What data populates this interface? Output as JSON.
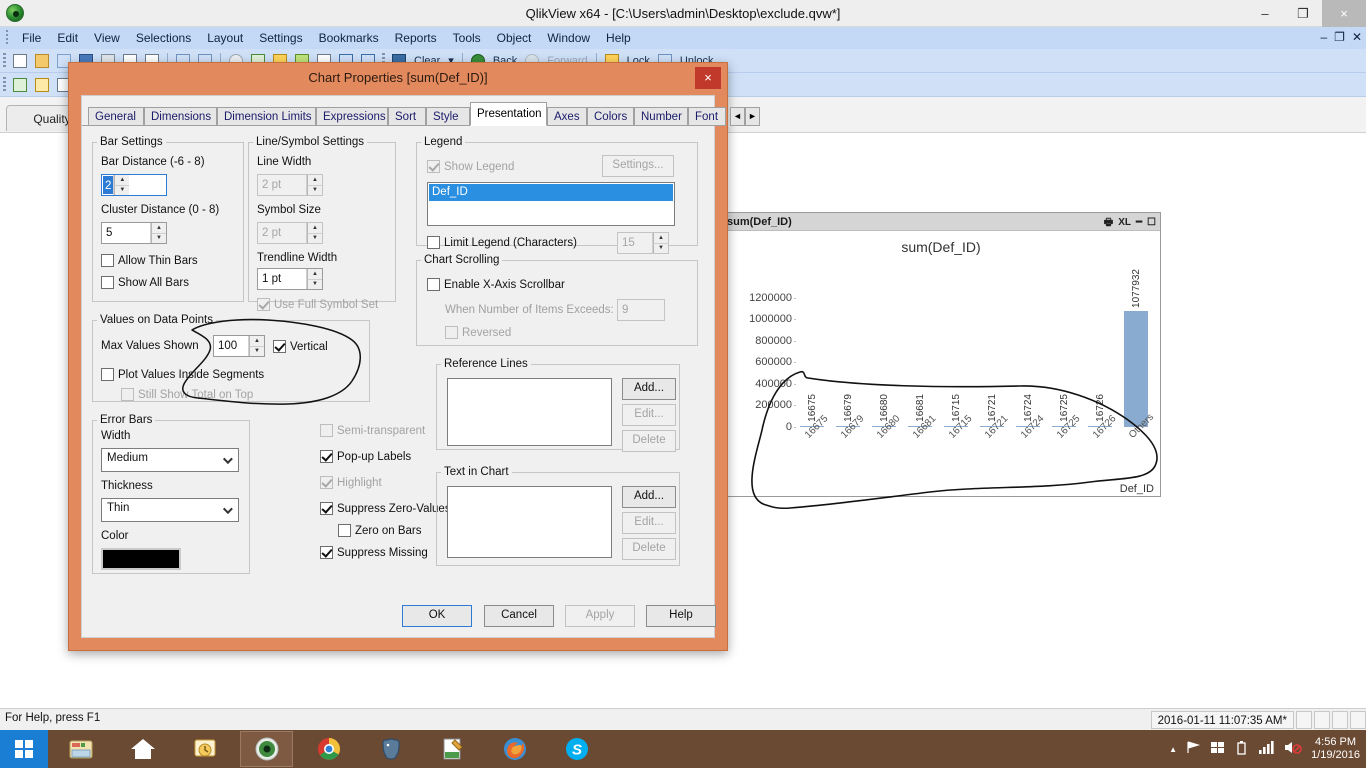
{
  "window": {
    "title": "QlikView x64 - [C:\\Users\\admin\\Desktop\\exclude.qvw*]",
    "app_icon": "qlikview-icon",
    "minimize": "–",
    "maximize": "❐",
    "close": "×",
    "doc_minimize": "–",
    "doc_restore": "❐",
    "doc_close": "✕"
  },
  "menubar": {
    "items": [
      "File",
      "Edit",
      "View",
      "Selections",
      "Layout",
      "Settings",
      "Bookmarks",
      "Reports",
      "Tools",
      "Object",
      "Window",
      "Help"
    ]
  },
  "toolbar": {
    "clear": "Clear",
    "back": "Back",
    "forward": "Forward",
    "lock": "Lock",
    "unlock": "Unlock"
  },
  "document": {
    "sheet_tab": "Quality"
  },
  "chart_object": {
    "caption": "sum(Def_ID)",
    "buttons": [
      "print-icon",
      "XL",
      "minimize-icon",
      "maximize-icon"
    ]
  },
  "chart_data": {
    "type": "bar",
    "title": "sum(Def_ID)",
    "xlabel": "Def_ID",
    "ylabel": "",
    "categories": [
      "16675",
      "16679",
      "16680",
      "16681",
      "16715",
      "16721",
      "16724",
      "16725",
      "16726",
      "Others"
    ],
    "values": [
      16675,
      16679,
      16680,
      16681,
      16715,
      16721,
      16724,
      16725,
      16726,
      1077932
    ],
    "value_labels": [
      "16675",
      "16679",
      "16680",
      "16681",
      "16715",
      "16721",
      "16724",
      "16725",
      "16726",
      "1077932"
    ],
    "ylim": [
      0,
      1300000
    ],
    "yticks": [
      0,
      200000,
      400000,
      600000,
      800000,
      1000000,
      1200000
    ],
    "ytick_labels": [
      "0",
      "200000",
      "400000",
      "600000",
      "800000",
      "1000000",
      "1200000"
    ],
    "grid": false,
    "legend": "none",
    "bar_color": "#8aabd0",
    "values_vertical": true
  },
  "annotation": {
    "type": "freehand-ink",
    "color": "#000000",
    "description": "hand-drawn loop circling the Values on Data Points area and the chart x-axis"
  },
  "dialog": {
    "title": "Chart Properties [sum(Def_ID)]",
    "close": "×",
    "tabs": [
      {
        "label": "General",
        "active": false
      },
      {
        "label": "Dimensions",
        "active": false
      },
      {
        "label": "Dimension Limits",
        "active": false
      },
      {
        "label": "Expressions",
        "active": false
      },
      {
        "label": "Sort",
        "active": false
      },
      {
        "label": "Style",
        "active": false
      },
      {
        "label": "Presentation",
        "active": true
      },
      {
        "label": "Axes",
        "active": false
      },
      {
        "label": "Colors",
        "active": false
      },
      {
        "label": "Number",
        "active": false
      },
      {
        "label": "Font",
        "active": false
      }
    ],
    "tab_nav_prev": "◄",
    "tab_nav_next": "►",
    "bar_settings": {
      "legend": "Bar Settings",
      "bar_distance_label": "Bar Distance (-6 - 8)",
      "bar_distance_value": "2",
      "cluster_distance_label": "Cluster Distance (0 - 8)",
      "cluster_distance_value": "5",
      "allow_thin_bars": "Allow Thin Bars",
      "allow_thin_bars_checked": false,
      "show_all_bars": "Show All Bars",
      "show_all_bars_checked": false
    },
    "line_symbol_settings": {
      "legend": "Line/Symbol Settings",
      "line_width_label": "Line Width",
      "line_width_value": "2 pt",
      "symbol_size_label": "Symbol Size",
      "symbol_size_value": "2 pt",
      "trendline_width_label": "Trendline Width",
      "trendline_width_value": "1 pt",
      "use_full_symbol_set": "Use Full Symbol Set",
      "use_full_symbol_set_checked": true
    },
    "legend_group": {
      "legend": "Legend",
      "show_legend": "Show Legend",
      "show_legend_checked": true,
      "settings_button": "Settings...",
      "list_items": [
        "Def_ID"
      ],
      "limit_legend": "Limit Legend (Characters)",
      "limit_legend_checked": false,
      "limit_legend_value": "15"
    },
    "chart_scrolling": {
      "legend": "Chart Scrolling",
      "enable_scrollbar": "Enable X-Axis Scrollbar",
      "enable_scrollbar_checked": false,
      "when_exceeds_label": "When Number of Items Exceeds:",
      "when_exceeds_value": "9",
      "reversed": "Reversed",
      "reversed_checked": false
    },
    "values_on_data_points": {
      "legend": "Values on Data Points",
      "max_values_shown_label": "Max Values Shown",
      "max_values_shown_value": "100",
      "vertical": "Vertical",
      "vertical_checked": true,
      "plot_values_inside_segments": "Plot Values Inside Segments",
      "plot_values_inside_segments_checked": false,
      "still_show_total_on_top": "Still Show Total on Top",
      "still_show_total_on_top_checked": false
    },
    "error_bars": {
      "legend": "Error Bars",
      "width_label": "Width",
      "width_value": "Medium",
      "thickness_label": "Thickness",
      "thickness_value": "Thin",
      "color_label": "Color",
      "color_value": "#000000"
    },
    "misc_options": [
      {
        "label": "Semi-transparent",
        "checked": false,
        "disabled": true
      },
      {
        "label": "Pop-up Labels",
        "checked": true,
        "disabled": false
      },
      {
        "label": "Highlight",
        "checked": true,
        "disabled": true
      },
      {
        "label": "Suppress Zero-Values",
        "checked": true,
        "disabled": false
      },
      {
        "label": "Zero on Bars",
        "checked": false,
        "disabled": false
      },
      {
        "label": "Suppress Missing",
        "checked": true,
        "disabled": false
      }
    ],
    "reference_lines": {
      "legend": "Reference Lines",
      "add": "Add...",
      "edit": "Edit...",
      "delete": "Delete"
    },
    "text_in_chart": {
      "legend": "Text in Chart",
      "add": "Add...",
      "edit": "Edit...",
      "delete": "Delete"
    },
    "buttons": {
      "ok": "OK",
      "cancel": "Cancel",
      "apply": "Apply",
      "help": "Help"
    }
  },
  "statusbar": {
    "hint": "For Help, press F1",
    "timestamp": "2016-01-11 11:07:35 AM*"
  },
  "taskbar": {
    "start": "start-button",
    "items": [
      {
        "name": "file-explorer-icon"
      },
      {
        "name": "home-icon"
      },
      {
        "name": "outlook-icon"
      },
      {
        "name": "qlikview-icon",
        "active": true
      },
      {
        "name": "chrome-icon"
      },
      {
        "name": "postgresql-icon"
      },
      {
        "name": "notepadpp-icon"
      },
      {
        "name": "firefox-icon"
      },
      {
        "name": "skype-icon"
      }
    ],
    "tray": {
      "chevron": "▲",
      "network": "network-icon",
      "action-center": "action-center-icon",
      "battery": "battery-icon",
      "signal": "signal-icon",
      "volume": "volume-muted-icon",
      "time": "4:56 PM",
      "date": "1/19/2016"
    }
  }
}
